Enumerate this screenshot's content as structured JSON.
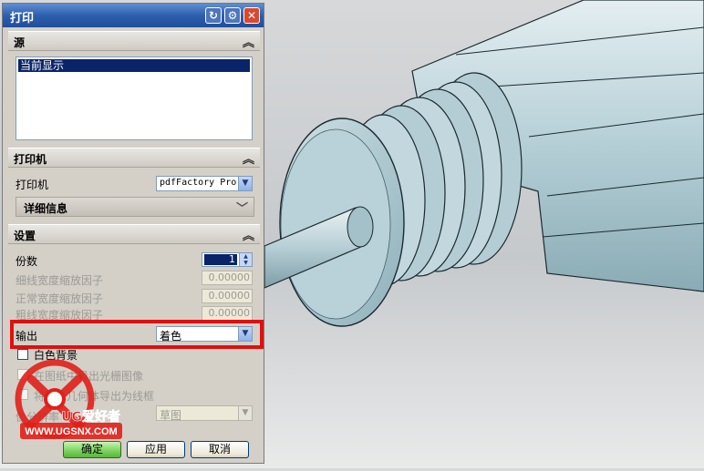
{
  "dialog": {
    "title": "打印",
    "title_icons": [
      "reset-icon",
      "gear-icon",
      "close-icon"
    ]
  },
  "source": {
    "header": "源",
    "list_items": [
      "当前显示"
    ]
  },
  "printer": {
    "header": "打印机",
    "printer_label": "打印机",
    "printer_value": "pdfFactory Pro",
    "details_label": "详细信息"
  },
  "settings": {
    "header": "设置",
    "copies_label": "份数",
    "copies_value": "1",
    "thin_width_label": "细线宽度缩放因子",
    "thin_width_value": "0.00000",
    "normal_width_label": "正常宽度缩放因子",
    "normal_width_value": "0.00000",
    "thick_width_label": "粗线宽度缩放因子",
    "thick_width_value": "0.00000",
    "output_label": "输出",
    "output_value": "着色",
    "bw_label": "白色背景",
    "raster_label": "在图纸中导出光栅图像",
    "wireframe_label": "将着色几何体导出为线框",
    "pixel_label": "像分辨率",
    "pixel_value": "草图"
  },
  "buttons": {
    "ok": "确定",
    "apply": "应用",
    "cancel": "取消"
  },
  "watermark": {
    "brand": "UG爱好者",
    "url": "WWW.UGSNX.COM"
  },
  "colors": {
    "highlight": "#e01010",
    "title_bar": "#2d5fae",
    "model": "#a9c8d2"
  }
}
